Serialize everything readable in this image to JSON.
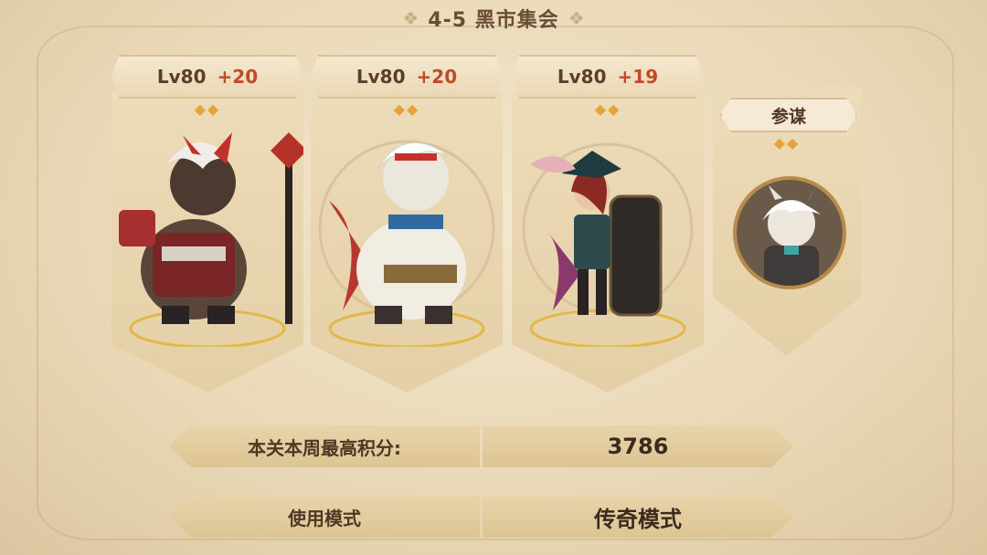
{
  "stage": {
    "title": "4-5 黑市集会"
  },
  "heroes": [
    {
      "level": "Lv80",
      "bonus": "+20",
      "stars": "◆◆",
      "name_icon": "bear-warrior-hero",
      "theme": "#9a2c2c"
    },
    {
      "level": "Lv80",
      "bonus": "+20",
      "stars": "◆◆",
      "name_icon": "white-bear-hero",
      "theme": "#b6382f"
    },
    {
      "level": "Lv80",
      "bonus": "+19",
      "stars": "◆◆",
      "name_icon": "pirate-girl-hero",
      "theme": "#2f4a4a"
    }
  ],
  "advisor": {
    "label": "参谋",
    "stars": "◆◆",
    "name_icon": "advisor-portrait"
  },
  "score": {
    "label": "本关本周最高积分:",
    "value": "3786"
  },
  "mode": {
    "label": "使用模式",
    "value": "传奇模式"
  },
  "colors": {
    "accent_red": "#c04a2a",
    "parchment": "#ead9b8",
    "gold": "#e3b84a"
  }
}
